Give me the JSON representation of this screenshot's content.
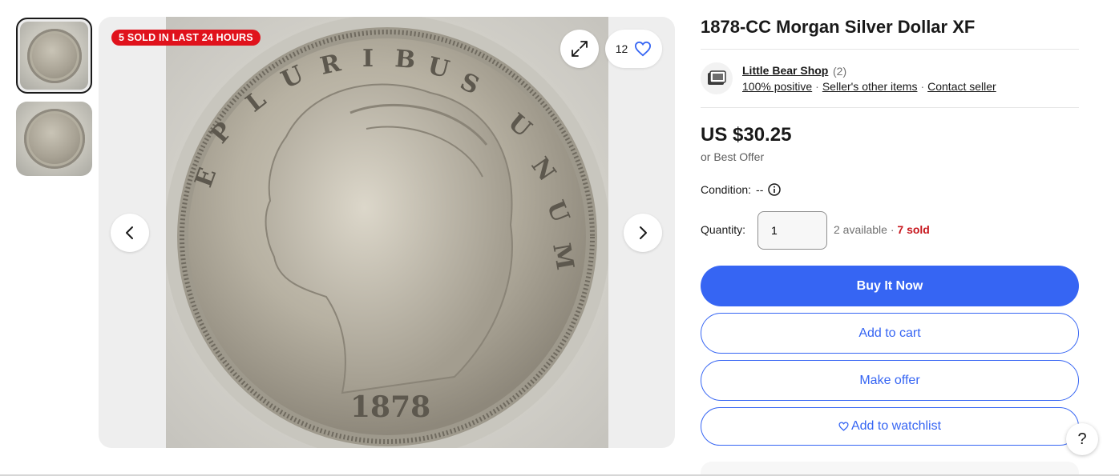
{
  "gallery": {
    "badge": "5 SOLD IN LAST 24 HOURS",
    "watch_count": "12",
    "thumbnails": [
      {
        "name": "thumbnail-obverse",
        "active": true
      },
      {
        "name": "thumbnail-reverse",
        "active": false
      }
    ],
    "icons": {
      "expand": "expand-icon",
      "heart": "heart-icon",
      "prev": "chevron-left-icon",
      "next": "chevron-right-icon"
    }
  },
  "listing": {
    "title": "1878-CC Morgan Silver Dollar XF",
    "seller": {
      "name": "Little Bear Shop",
      "count": "(2)",
      "positive": "100% positive",
      "other_items": "Seller's other items",
      "contact": "Contact seller",
      "avatar_icon": "store-avatar-icon"
    },
    "price": "US $30.25",
    "best_offer": "or Best Offer",
    "condition_label": "Condition:",
    "condition_value": "--",
    "quantity_label": "Quantity:",
    "quantity_value": "1",
    "available": "2 available",
    "separator": "·",
    "sold": "7 sold"
  },
  "actions": {
    "buy_now": "Buy It Now",
    "add_to_cart": "Add to cart",
    "make_offer": "Make offer",
    "add_to_watchlist": "Add to watchlist"
  },
  "help": "?",
  "colors": {
    "primary": "#3665f3",
    "badge": "#e0121c",
    "sold_text": "#c7161d"
  }
}
